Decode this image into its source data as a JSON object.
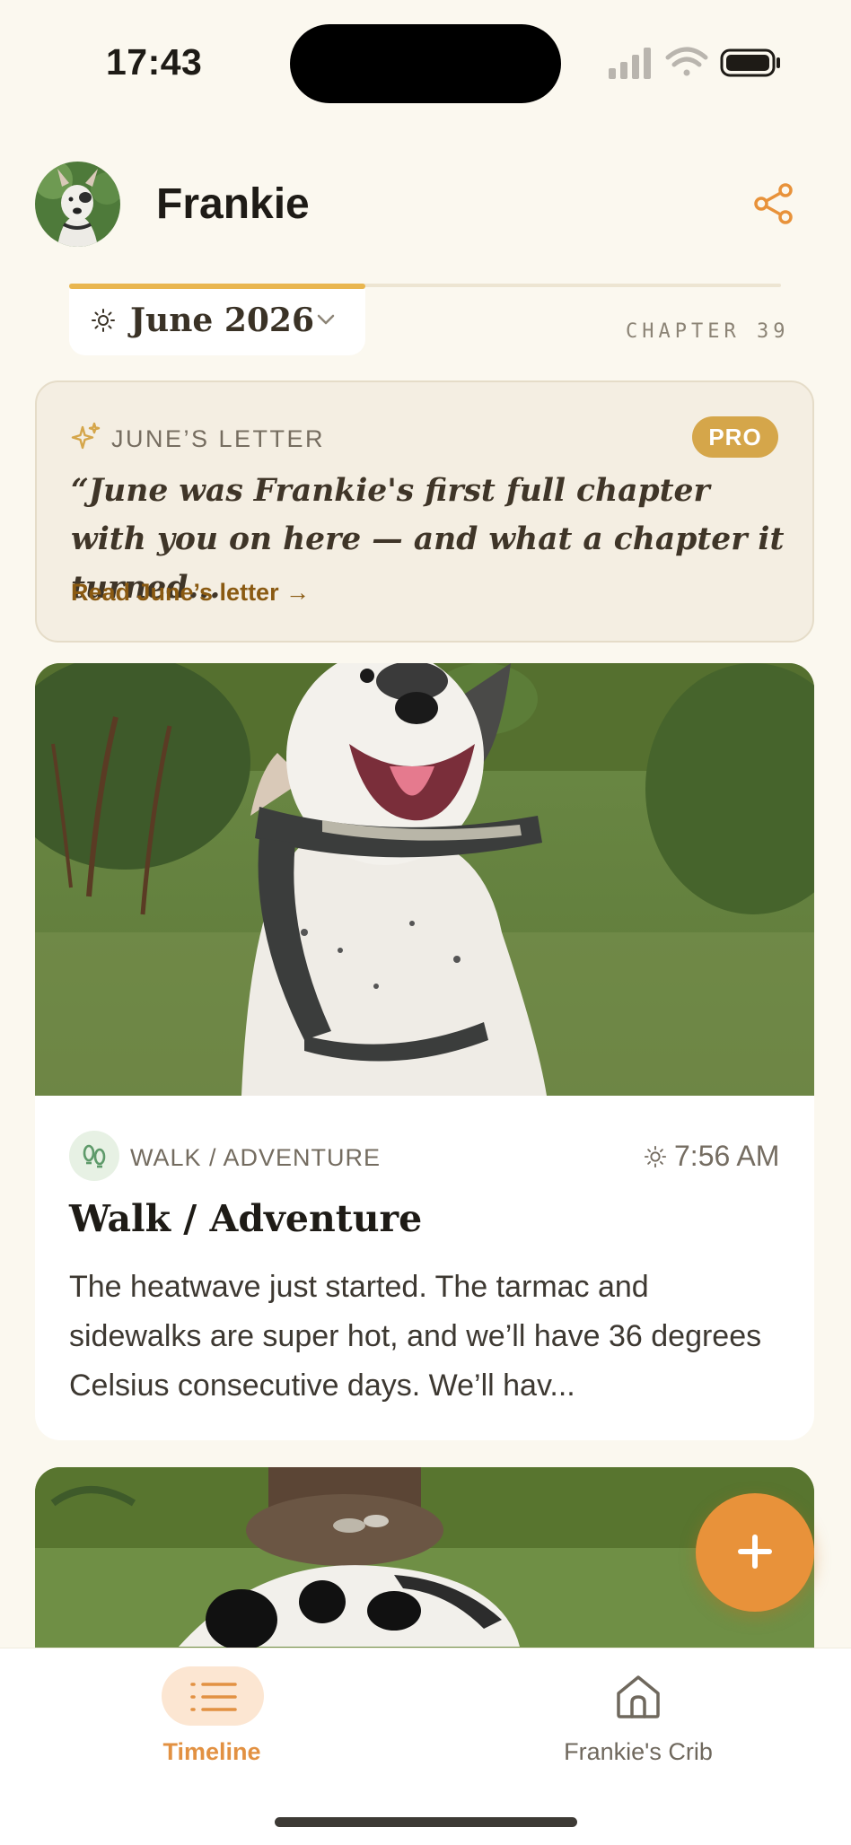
{
  "status_bar": {
    "time": "17:43"
  },
  "header": {
    "pet_name": "Frankie"
  },
  "month": {
    "label": "June 2026",
    "chapter": "CHAPTER 39"
  },
  "letter": {
    "title": "JUNE’S LETTER",
    "badge": "PRO",
    "quote": "“June was Frankie's first full chapter with you on here — and what a chapter it turned...",
    "link": "Read June’s letter →"
  },
  "posts": [
    {
      "category": "WALK / ADVENTURE",
      "time": "7:56 AM",
      "title": "Walk / Adventure",
      "body": "The heatwave just started. The tarmac and sidewalks are super hot, and we’ll have 36 degrees Celsius consecutive days. We’ll hav..."
    }
  ],
  "bottom_nav": {
    "items": [
      {
        "label": "Timeline",
        "icon": "list-icon",
        "active": true
      },
      {
        "label": "Frankie's Crib",
        "icon": "home-icon",
        "active": false
      }
    ]
  },
  "colors": {
    "background": "#FBF8EF",
    "accent_orange": "#E8923A",
    "gold": "#D5A64A",
    "brown_link": "#8A5A12"
  }
}
